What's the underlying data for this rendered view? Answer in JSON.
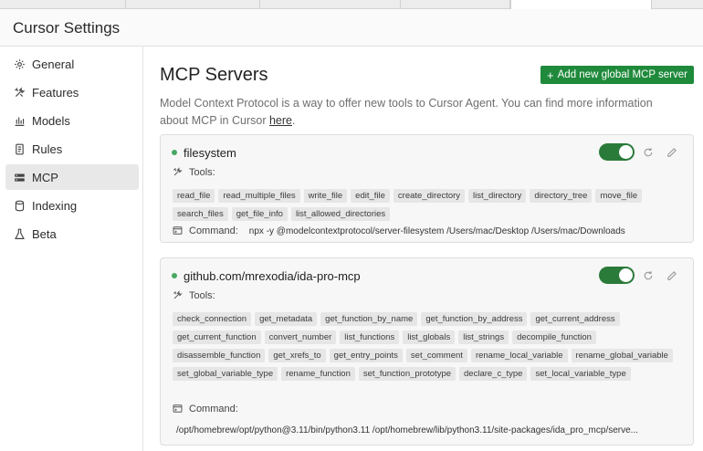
{
  "window": {
    "title": "Cursor Settings"
  },
  "sidebar": {
    "items": [
      {
        "label": "General",
        "icon": "gear-icon"
      },
      {
        "label": "Features",
        "icon": "tools-icon"
      },
      {
        "label": "Models",
        "icon": "bar-chart-icon"
      },
      {
        "label": "Rules",
        "icon": "document-icon"
      },
      {
        "label": "MCP",
        "icon": "server-icon",
        "active": true
      },
      {
        "label": "Indexing",
        "icon": "database-icon"
      },
      {
        "label": "Beta",
        "icon": "flask-icon"
      }
    ]
  },
  "main": {
    "title": "MCP Servers",
    "add_button": "Add new global MCP server",
    "description": "Model Context Protocol is a way to offer new tools to Cursor Agent. You can find more information about MCP in Cursor",
    "description_link": "here",
    "description_end": "."
  },
  "servers": [
    {
      "name": "filesystem",
      "enabled": true,
      "tools_label": "Tools:",
      "tools": [
        "read_file",
        "read_multiple_files",
        "write_file",
        "edit_file",
        "create_directory",
        "list_directory",
        "directory_tree",
        "move_file",
        "search_files",
        "get_file_info",
        "list_allowed_directories"
      ],
      "command_label": "Command:",
      "command": "npx -y @modelcontextprotocol/server-filesystem /Users/mac/Desktop /Users/mac/Downloads"
    },
    {
      "name": "github.com/mrexodia/ida-pro-mcp",
      "enabled": true,
      "tools_label": "Tools:",
      "tools": [
        "check_connection",
        "get_metadata",
        "get_function_by_name",
        "get_function_by_address",
        "get_current_address",
        "get_current_function",
        "convert_number",
        "list_functions",
        "list_globals",
        "list_strings",
        "decompile_function",
        "disassemble_function",
        "get_xrefs_to",
        "get_entry_points",
        "set_comment",
        "rename_local_variable",
        "rename_global_variable",
        "set_global_variable_type",
        "rename_function",
        "set_function_prototype",
        "declare_c_type",
        "set_local_variable_type"
      ],
      "command_label": "Command:",
      "command": "/opt/homebrew/opt/python@3.11/bin/python3.11 /opt/homebrew/lib/python3.11/site-packages/ida_pro_mcp/serve..."
    }
  ],
  "colors": {
    "accent": "#1f8a3b",
    "toggle_on": "#2a7a3a",
    "status_dot": "#47a862"
  }
}
